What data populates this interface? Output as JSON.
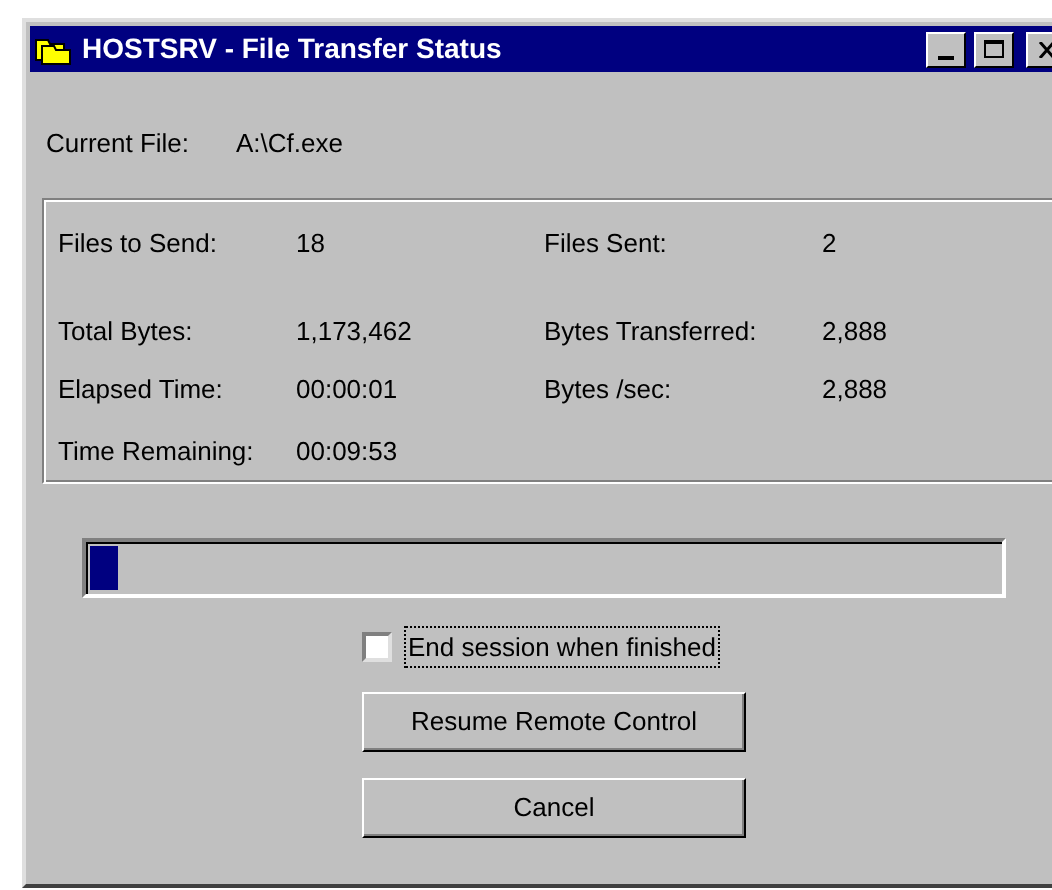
{
  "window": {
    "title": "HOSTSRV - File Transfer Status"
  },
  "current_file": {
    "label": "Current File:",
    "value": "A:\\Cf.exe"
  },
  "stats": [
    {
      "label": "Files to Send:",
      "value": "18",
      "label_2": "Files Sent:",
      "value_2": "2"
    },
    {
      "label": "Total Bytes:",
      "value": "1,173,462",
      "label_2": "Bytes Transferred:",
      "value_2": "2,888"
    },
    {
      "label": "Elapsed Time:",
      "value": "00:00:01",
      "label_2": "Bytes /sec:",
      "value_2": "2,888"
    },
    {
      "label": "Time Remaining:",
      "value": "00:09:53"
    }
  ],
  "progress": {
    "level": 0.03
  },
  "end_session": {
    "label": "End session when finished",
    "checked": false
  },
  "buttons": [
    "Resume Remote Control",
    "Cancel"
  ]
}
